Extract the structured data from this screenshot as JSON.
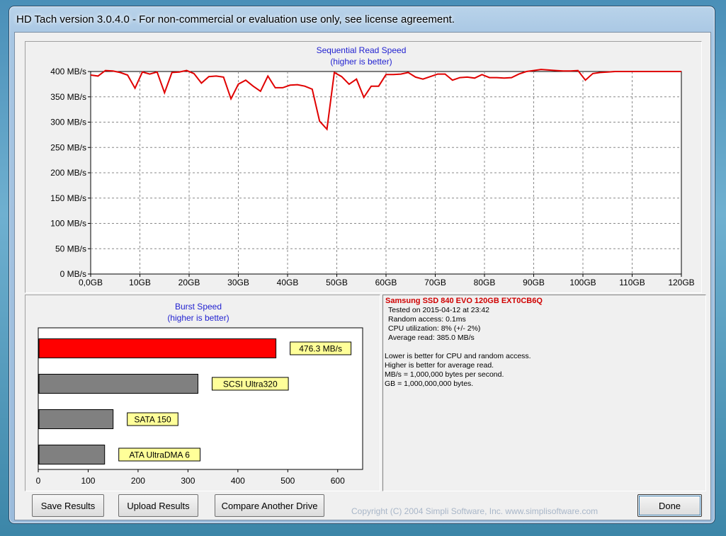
{
  "window": {
    "title": "HD Tach version 3.0.4.0  - For non-commercial or evaluation use only, see license agreement."
  },
  "sequential": {
    "title": "Sequential Read Speed",
    "subtitle": "(higher is better)"
  },
  "burst": {
    "title": "Burst Speed",
    "subtitle": "(higher is better)"
  },
  "info": {
    "drive": "Samsung SSD 840 EVO 120GB EXT0CB6Q",
    "lines": [
      "Tested on 2015-04-12 at 23:42",
      "Random access: 0.1ms",
      "CPU utilization: 8% (+/- 2%)",
      "Average read: 385.0 MB/s"
    ],
    "notes": [
      "Lower is better for CPU and random access.",
      "Higher is better for average read.",
      "MB/s = 1,000,000 bytes per second.",
      "GB = 1,000,000,000 bytes."
    ]
  },
  "buttons": {
    "save": "Save Results",
    "upload": "Upload Results",
    "compare": "Compare Another Drive",
    "done": "Done"
  },
  "copyright": "Copyright (C) 2004 Simpli Software, Inc. www.simplisoftware.com",
  "chart_data": [
    {
      "type": "line",
      "title": "Sequential Read Speed",
      "subtitle": "(higher is better)",
      "xlabel": "",
      "ylabel": "",
      "xlim": [
        0,
        120
      ],
      "ylim": [
        0,
        400
      ],
      "x_ticks": [
        "0,0GB",
        "10GB",
        "20GB",
        "30GB",
        "40GB",
        "50GB",
        "60GB",
        "70GB",
        "80GB",
        "90GB",
        "100GB",
        "110GB",
        "120GB"
      ],
      "y_ticks": [
        "0 MB/s",
        "50 MB/s",
        "100 MB/s",
        "150 MB/s",
        "200 MB/s",
        "250 MB/s",
        "300 MB/s",
        "350 MB/s",
        "400 MB/s"
      ],
      "grid": true,
      "series_color": "#e00000",
      "series": [
        {
          "x": [
            0,
            1.5,
            3,
            4.5,
            6,
            7.5,
            9,
            10.5,
            12,
            13.5,
            15,
            16.5,
            18,
            19.5,
            21,
            22.5,
            24,
            25.5,
            27,
            28.5,
            30,
            31.5,
            33,
            34.5,
            36,
            37.5,
            39,
            40.5,
            42,
            43.5,
            45,
            46.5,
            48,
            49.5,
            51,
            52.5,
            54,
            55.5,
            57,
            58.5,
            60,
            61.5,
            63,
            64.5,
            66,
            67.5,
            69,
            70.5,
            72,
            73.5,
            75,
            76.5,
            78,
            79.5,
            81,
            82.5,
            84,
            85.5,
            87,
            88.5,
            90,
            91.5,
            93,
            94.5,
            96,
            97.5,
            99,
            100.5,
            102,
            103.5,
            105,
            106.5,
            108,
            109.5,
            111,
            112.5,
            114,
            115.5,
            117,
            118.5,
            120
          ],
          "y": [
            393,
            391,
            402,
            401,
            398,
            393,
            367,
            399,
            395,
            399,
            358,
            398,
            399,
            402,
            396,
            377,
            390,
            391,
            389,
            346,
            375,
            383,
            371,
            361,
            391,
            368,
            368,
            373,
            374,
            371,
            365,
            302,
            286,
            398,
            390,
            375,
            385,
            349,
            371,
            371,
            394,
            394,
            395,
            398,
            389,
            385,
            390,
            395,
            395,
            383,
            388,
            389,
            387,
            394,
            388,
            388,
            387,
            388,
            395,
            400,
            402,
            404,
            403,
            402,
            401,
            401,
            402,
            383,
            396,
            398,
            399,
            400,
            400,
            400,
            400,
            400,
            400,
            400,
            400,
            400,
            400
          ]
        }
      ]
    },
    {
      "type": "bar",
      "title": "Burst Speed",
      "subtitle": "(higher is better)",
      "orientation": "horizontal",
      "categories": [
        "476.3 MB/s",
        "SCSI Ultra320",
        "SATA 150",
        "ATA UltraDMA 6"
      ],
      "values": [
        476.3,
        320,
        150,
        133
      ],
      "colors": [
        "#ff0000",
        "#808080",
        "#808080",
        "#808080"
      ],
      "xlim": [
        0,
        650
      ],
      "x_ticks": [
        "0",
        "100",
        "200",
        "300",
        "400",
        "500",
        "600"
      ]
    }
  ]
}
